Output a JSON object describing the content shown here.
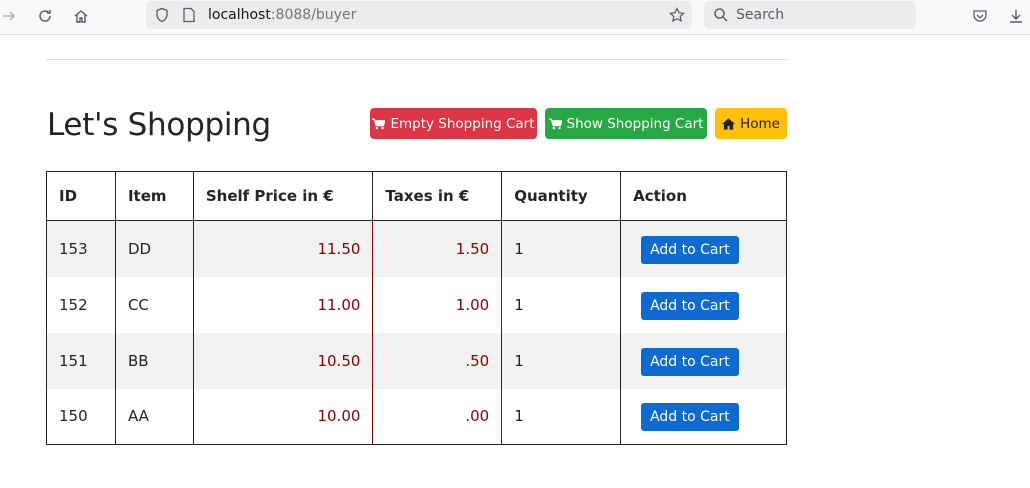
{
  "browser": {
    "url_host": "localhost",
    "url_rest": ":8088/buyer",
    "search_placeholder": "Search"
  },
  "page": {
    "title": "Let's Shopping"
  },
  "buttons": {
    "empty_cart": "Empty Shopping Cart",
    "show_cart": "Show Shopping Cart",
    "home": "Home"
  },
  "table": {
    "headers": [
      "ID",
      "Item",
      "Shelf Price in €",
      "Taxes in €",
      "Quantity",
      "Action"
    ],
    "rows": [
      {
        "id": "153",
        "item": "DD",
        "price": "11.50",
        "tax": "1.50",
        "qty": "1",
        "action": "Add to Cart"
      },
      {
        "id": "152",
        "item": "CC",
        "price": "11.00",
        "tax": "1.00",
        "qty": "1",
        "action": "Add to Cart"
      },
      {
        "id": "151",
        "item": "BB",
        "price": "10.50",
        "tax": ".50",
        "qty": "1",
        "action": "Add to Cart"
      },
      {
        "id": "150",
        "item": "AA",
        "price": "10.00",
        "tax": ".00",
        "qty": "1",
        "action": "Add to Cart"
      }
    ]
  },
  "colors": {
    "danger": "#dc3545",
    "success": "#28a745",
    "warning": "#ffc107",
    "primary": "#0d6ad0",
    "price_text": "#8b0000"
  }
}
